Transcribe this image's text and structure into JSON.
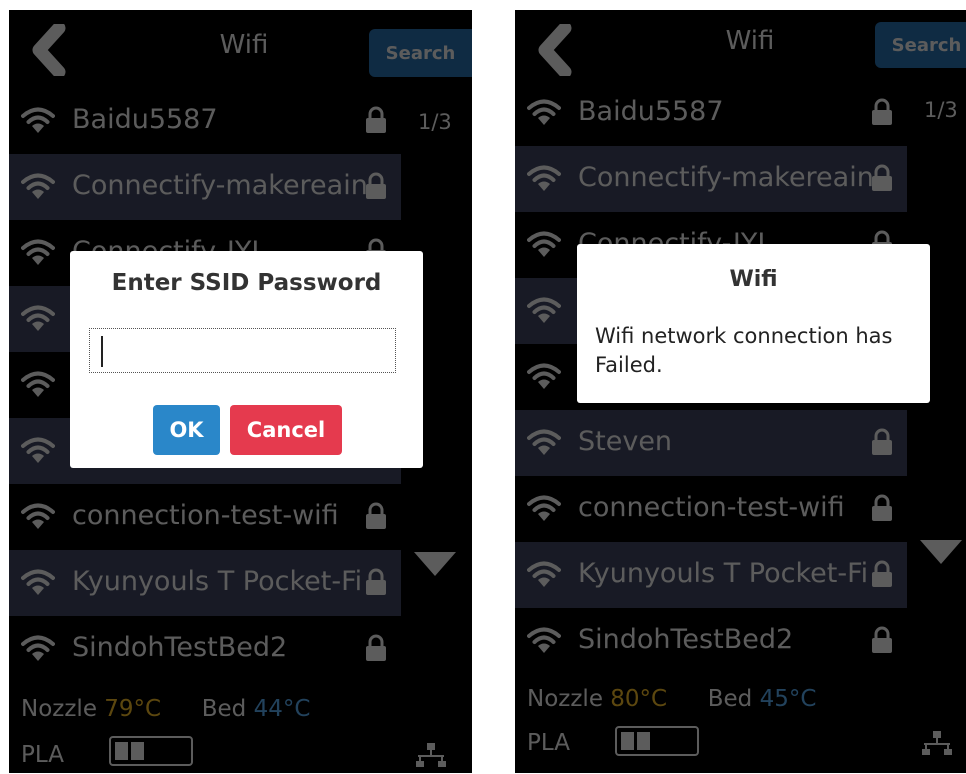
{
  "colors": {
    "screen_bg": "#000000",
    "row_highlight": "#444a66",
    "search_button": "#2a77b9",
    "ok_button": "#2a87c9",
    "cancel_button": "#e53a4e",
    "nozzle_temp": "#ffc62b",
    "bed_temp": "#5fb6ff"
  },
  "left_screen": {
    "header": {
      "title": "Wifi",
      "search_label": "Search",
      "back_icon": "back-chevron-icon"
    },
    "page_indicator": "1/3",
    "networks": [
      {
        "ssid": "Baidu5587",
        "locked": true,
        "highlight": false
      },
      {
        "ssid": "Connectify-makereain",
        "locked": true,
        "highlight": true
      },
      {
        "ssid": "Connectify-JYL",
        "locked": true,
        "highlight": false
      },
      {
        "ssid": "",
        "locked": true,
        "highlight": true
      },
      {
        "ssid": "",
        "locked": true,
        "highlight": false
      },
      {
        "ssid": "",
        "locked": true,
        "highlight": true
      },
      {
        "ssid": "connection-test-wifi",
        "locked": true,
        "highlight": false
      },
      {
        "ssid": "Kyunyouls T Pocket-Fi",
        "locked": true,
        "highlight": true
      },
      {
        "ssid": "SindohTestBed2",
        "locked": true,
        "highlight": false
      }
    ],
    "status": {
      "nozzle_label": "Nozzle",
      "nozzle_value": "79°C",
      "bed_label": "Bed",
      "bed_value": "44°C",
      "filament": "PLA"
    },
    "dialog": {
      "title": "Enter SSID Password",
      "input_value": "",
      "ok_label": "OK",
      "cancel_label": "Cancel"
    }
  },
  "right_screen": {
    "header": {
      "title": "Wifi",
      "search_label": "Search",
      "back_icon": "back-chevron-icon"
    },
    "page_indicator": "1/3",
    "networks": [
      {
        "ssid": "Baidu5587",
        "locked": true,
        "highlight": false
      },
      {
        "ssid": "Connectify-makereain",
        "locked": true,
        "highlight": true
      },
      {
        "ssid": "Connectify-JYL",
        "locked": true,
        "highlight": false
      },
      {
        "ssid": "",
        "locked": true,
        "highlight": true
      },
      {
        "ssid": "",
        "locked": true,
        "highlight": false
      },
      {
        "ssid": "Steven",
        "locked": true,
        "highlight": true
      },
      {
        "ssid": "connection-test-wifi",
        "locked": true,
        "highlight": false
      },
      {
        "ssid": "Kyunyouls T Pocket-Fi",
        "locked": true,
        "highlight": true
      },
      {
        "ssid": "SindohTestBed2",
        "locked": true,
        "highlight": false
      }
    ],
    "status": {
      "nozzle_label": "Nozzle",
      "nozzle_value": "80°C",
      "bed_label": "Bed",
      "bed_value": "45°C",
      "filament": "PLA"
    },
    "dialog": {
      "title": "Wifi",
      "message": "Wifi network connection has Failed."
    }
  }
}
